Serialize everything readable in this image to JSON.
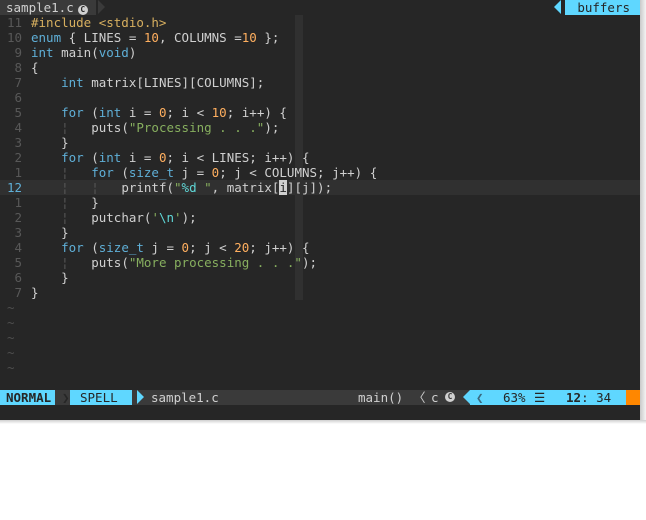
{
  "tabline": {
    "active_tab": "sample1.c",
    "active_tab_icon": "c-file-icon",
    "buffers_label": "buffers"
  },
  "editor": {
    "lines": [
      {
        "num": "11",
        "current": false
      },
      {
        "num": "10",
        "current": false
      },
      {
        "num": "9",
        "current": false
      },
      {
        "num": "8",
        "current": false
      },
      {
        "num": "7",
        "current": false
      },
      {
        "num": "6",
        "current": false
      },
      {
        "num": "5",
        "current": false
      },
      {
        "num": "4",
        "current": false
      },
      {
        "num": "3",
        "current": false
      },
      {
        "num": "2",
        "current": false
      },
      {
        "num": "1",
        "current": false
      },
      {
        "num": "12",
        "current": true
      },
      {
        "num": "1",
        "current": false
      },
      {
        "num": "2",
        "current": false
      },
      {
        "num": "3",
        "current": false
      },
      {
        "num": "4",
        "current": false
      },
      {
        "num": "5",
        "current": false
      },
      {
        "num": "6",
        "current": false
      },
      {
        "num": "7",
        "current": false
      }
    ],
    "code_tokens": [
      [
        [
          "pp",
          "#include <stdio.h>"
        ]
      ],
      [
        [
          "kw",
          "enum"
        ],
        [
          "",
          " { LINES = "
        ],
        [
          "num",
          "10"
        ],
        [
          "",
          ", COLUMNS ="
        ],
        [
          "num",
          "10"
        ],
        [
          "",
          " };"
        ]
      ],
      [
        [
          "kw",
          "int"
        ],
        [
          "",
          " main("
        ],
        [
          "kw",
          "void"
        ],
        [
          "",
          ")"
        ]
      ],
      [
        [
          "",
          "{"
        ]
      ],
      [
        [
          "",
          "    "
        ],
        [
          "kw",
          "int"
        ],
        [
          "",
          " matrix[LINES][COLUMNS];"
        ]
      ],
      [
        [
          "",
          ""
        ]
      ],
      [
        [
          "",
          "    "
        ],
        [
          "kw",
          "for"
        ],
        [
          "",
          " ("
        ],
        [
          "kw",
          "int"
        ],
        [
          "",
          " i = "
        ],
        [
          "num",
          "0"
        ],
        [
          "",
          "; i < "
        ],
        [
          "num",
          "10"
        ],
        [
          "",
          "; i++) {"
        ]
      ],
      [
        [
          "",
          "    "
        ],
        [
          "guide",
          "¦"
        ],
        [
          "",
          "   puts("
        ],
        [
          "str",
          "\"Processing . . .\""
        ],
        [
          "",
          ");"
        ]
      ],
      [
        [
          "",
          "    }"
        ]
      ],
      [
        [
          "",
          "    "
        ],
        [
          "kw",
          "for"
        ],
        [
          "",
          " ("
        ],
        [
          "kw",
          "int"
        ],
        [
          "",
          " i = "
        ],
        [
          "num",
          "0"
        ],
        [
          "",
          "; i < LINES; i++) {"
        ]
      ],
      [
        [
          "",
          "    "
        ],
        [
          "guide",
          "¦"
        ],
        [
          "",
          "   "
        ],
        [
          "kw",
          "for"
        ],
        [
          "",
          " ("
        ],
        [
          "kw",
          "size_t"
        ],
        [
          "",
          " j = "
        ],
        [
          "num",
          "0"
        ],
        [
          "",
          "; j < COLUMNS; j++) {"
        ]
      ],
      [
        [
          "",
          "    "
        ],
        [
          "guide",
          "¦"
        ],
        [
          "",
          "   "
        ],
        [
          "guide",
          "¦"
        ],
        [
          "",
          "   printf("
        ],
        [
          "str",
          "\""
        ],
        [
          "esc",
          "%d"
        ],
        [
          "str",
          " \""
        ],
        [
          "",
          ", matrix["
        ],
        [
          "cursor",
          "i"
        ],
        [
          "",
          "][j]);"
        ]
      ],
      [
        [
          "",
          "    "
        ],
        [
          "guide",
          "¦"
        ],
        [
          "",
          "   }"
        ]
      ],
      [
        [
          "",
          "    "
        ],
        [
          "guide",
          "¦"
        ],
        [
          "",
          "   putchar("
        ],
        [
          "str",
          "'"
        ],
        [
          "esc",
          "\\n"
        ],
        [
          "str",
          "'"
        ],
        [
          "",
          ");"
        ]
      ],
      [
        [
          "",
          "    }"
        ]
      ],
      [
        [
          "",
          "    "
        ],
        [
          "kw",
          "for"
        ],
        [
          "",
          " ("
        ],
        [
          "kw",
          "size_t"
        ],
        [
          "",
          " j = "
        ],
        [
          "num",
          "0"
        ],
        [
          "",
          "; j < "
        ],
        [
          "num",
          "20"
        ],
        [
          "",
          "; j++) {"
        ]
      ],
      [
        [
          "",
          "    "
        ],
        [
          "guide",
          "¦"
        ],
        [
          "",
          "   puts("
        ],
        [
          "str",
          "\"More processing . . .\""
        ],
        [
          "",
          ");"
        ]
      ],
      [
        [
          "",
          "    }"
        ]
      ],
      [
        [
          "",
          "}"
        ]
      ]
    ],
    "tilde": "~",
    "tilde_rows": 5
  },
  "statusline": {
    "mode": "NORMAL",
    "spell": "SPELL",
    "filename": "sample1.c",
    "function": "main()",
    "separator_glyph": "〈",
    "filetype": "c",
    "filetype_icon": "c-file-icon",
    "percent": "63%",
    "lines_icon": "☰",
    "line": "12",
    "col_sep": ":",
    "col": "34"
  },
  "colors": {
    "background": "#262626",
    "accent": "#5fd7ff",
    "keyword": "#5fafd7",
    "string": "#87af5f",
    "number": "#ffaf5f",
    "preproc": "#d7af5f",
    "warning": "#ff8700"
  }
}
